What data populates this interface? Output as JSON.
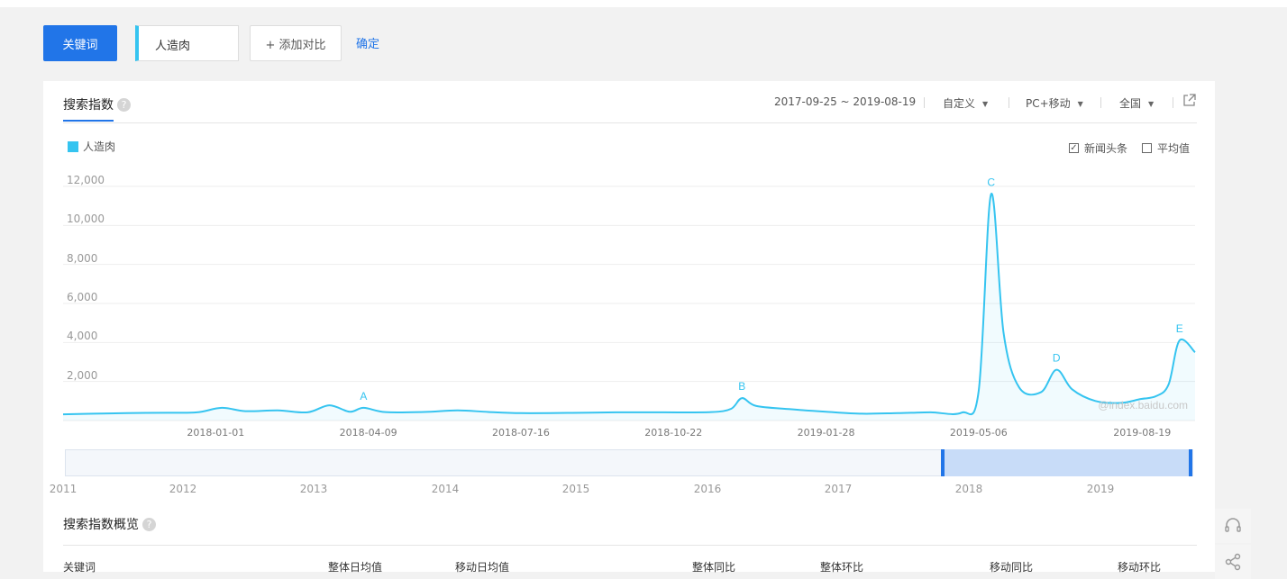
{
  "toolbar": {
    "keyword_button": "关键词",
    "keyword_value": "人造肉",
    "add_compare": "+ 添加对比",
    "confirm": "确定"
  },
  "card": {
    "tab_title": "搜索指数",
    "date_range": "2017-09-25 ~ 2019-08-19",
    "filter_custom": "自定义",
    "filter_device": "PC+移动",
    "filter_region": "全国",
    "legend_label": "人造肉",
    "option_news": "新闻头条",
    "option_average": "平均值",
    "watermark": "@index.baidu.com",
    "overview_title": "搜索指数概览",
    "overview_headers": [
      "关键词",
      "整体日均值",
      "移动日均值",
      "整体同比",
      "整体环比",
      "移动同比",
      "移动环比"
    ]
  },
  "colors": {
    "accent": "#2175e8",
    "series": "#35c4f0"
  },
  "icons": [
    "help-icon",
    "caret-down-icon",
    "export-icon",
    "checkbox-checked-icon",
    "checkbox-icon",
    "headset-icon",
    "share-icon"
  ],
  "chart_data": {
    "type": "area",
    "series": [
      {
        "name": "人造肉",
        "points": [
          [
            "2017-09-25",
            320
          ],
          [
            "2017-10-15",
            350
          ],
          [
            "2017-11-05",
            380
          ],
          [
            "2017-12-01",
            400
          ],
          [
            "2017-12-20",
            420
          ],
          [
            "2018-01-05",
            650
          ],
          [
            "2018-01-20",
            480
          ],
          [
            "2018-02-10",
            520
          ],
          [
            "2018-03-01",
            420
          ],
          [
            "2018-03-15",
            780
          ],
          [
            "2018-03-28",
            450
          ],
          [
            "2018-04-06",
            650
          ],
          [
            "2018-04-20",
            430
          ],
          [
            "2018-05-15",
            440
          ],
          [
            "2018-06-05",
            520
          ],
          [
            "2018-06-25",
            440
          ],
          [
            "2018-07-16",
            380
          ],
          [
            "2018-08-15",
            390
          ],
          [
            "2018-09-15",
            420
          ],
          [
            "2018-10-15",
            420
          ],
          [
            "2018-11-15",
            430
          ],
          [
            "2018-11-28",
            600
          ],
          [
            "2018-12-05",
            1150
          ],
          [
            "2018-12-14",
            750
          ],
          [
            "2019-01-05",
            580
          ],
          [
            "2019-01-28",
            450
          ],
          [
            "2019-02-20",
            350
          ],
          [
            "2019-03-15",
            380
          ],
          [
            "2019-04-05",
            420
          ],
          [
            "2019-04-25",
            400
          ],
          [
            "2019-05-06",
            1500
          ],
          [
            "2019-05-14",
            11600
          ],
          [
            "2019-05-22",
            4500
          ],
          [
            "2019-06-01",
            1700
          ],
          [
            "2019-06-15",
            1450
          ],
          [
            "2019-06-25",
            2600
          ],
          [
            "2019-07-05",
            1600
          ],
          [
            "2019-07-20",
            1000
          ],
          [
            "2019-08-05",
            900
          ],
          [
            "2019-08-18",
            1100
          ],
          [
            "2019-08-28",
            1250
          ],
          [
            "2019-09-05",
            1850
          ],
          [
            "2019-09-12",
            4100
          ],
          [
            "2019-09-22",
            3500
          ]
        ]
      }
    ],
    "x_ticks": [
      "2018-01-01",
      "2018-04-09",
      "2018-07-16",
      "2018-10-22",
      "2019-01-28",
      "2019-05-06",
      "2019-08-19"
    ],
    "y_ticks": [
      "2,000",
      "4,000",
      "6,000",
      "8,000",
      "10,000",
      "12,000"
    ],
    "ylim": [
      0,
      12000
    ],
    "annotations": [
      {
        "label": "A",
        "x": "2018-04-06",
        "y": 650
      },
      {
        "label": "B",
        "x": "2018-12-05",
        "y": 1150
      },
      {
        "label": "C",
        "x": "2019-05-14",
        "y": 11600
      },
      {
        "label": "D",
        "x": "2019-06-25",
        "y": 2600
      },
      {
        "label": "E",
        "x": "2019-09-12",
        "y": 4100
      }
    ],
    "overview_years": [
      "2011",
      "2012",
      "2013",
      "2014",
      "2015",
      "2016",
      "2017",
      "2018",
      "2019"
    ],
    "grid": true,
    "legend_position": "top-left"
  }
}
